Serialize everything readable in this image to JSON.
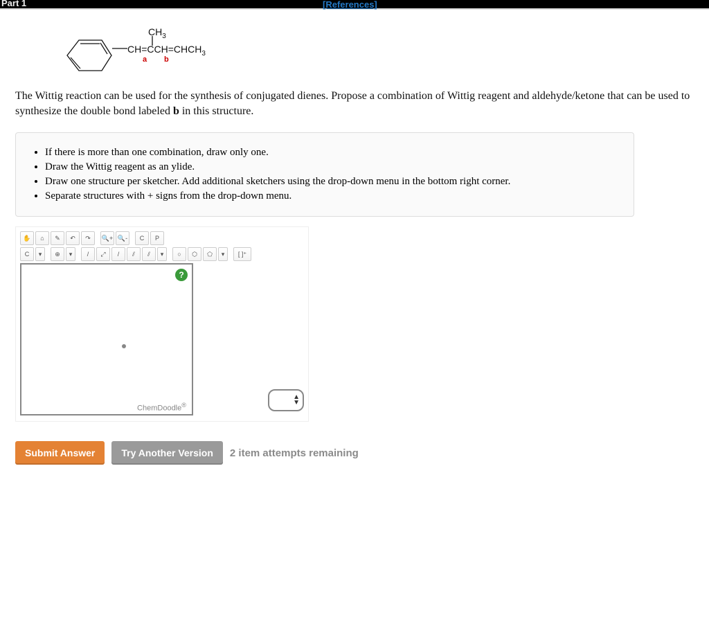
{
  "header": {
    "part": "Part 1",
    "references": "[References]"
  },
  "structure": {
    "ch3": "CH",
    "ch3_sub": "3",
    "chain": "CH=CCH=CHCH",
    "chain_sub": "3",
    "label_a": "a",
    "label_b": "b"
  },
  "question": "The Wittig reaction can be used for the synthesis of conjugated dienes. Propose a combination of Wittig reagent and aldehyde/ketone that can be used to synthesize the double bond labeled ",
  "question_b": "b",
  "question_tail": " in this structure.",
  "instructions": [
    "If there is more than one combination, draw only one.",
    "Draw the Wittig reagent as an ylide.",
    "Draw one structure per sketcher. Add additional sketchers using the drop-down menu in the bottom right corner.",
    "Separate structures with + signs from the drop-down menu."
  ],
  "sketcher": {
    "brand": "ChemDoodle",
    "help": "?",
    "toolbar1": [
      "✋",
      "⌂",
      "✎",
      "↶",
      "↷",
      "🔍+",
      "🔍-",
      "C",
      "P"
    ],
    "toolbar2": [
      "C",
      "▾",
      "⊕",
      "▾",
      "/",
      "⤢",
      "/",
      "⫽",
      "⫽",
      "▾",
      "○",
      "⬡",
      "⬠",
      "▾",
      "[ ]⁺"
    ]
  },
  "actions": {
    "submit": "Submit Answer",
    "try_another": "Try Another Version",
    "attempts": "2 item attempts remaining"
  }
}
